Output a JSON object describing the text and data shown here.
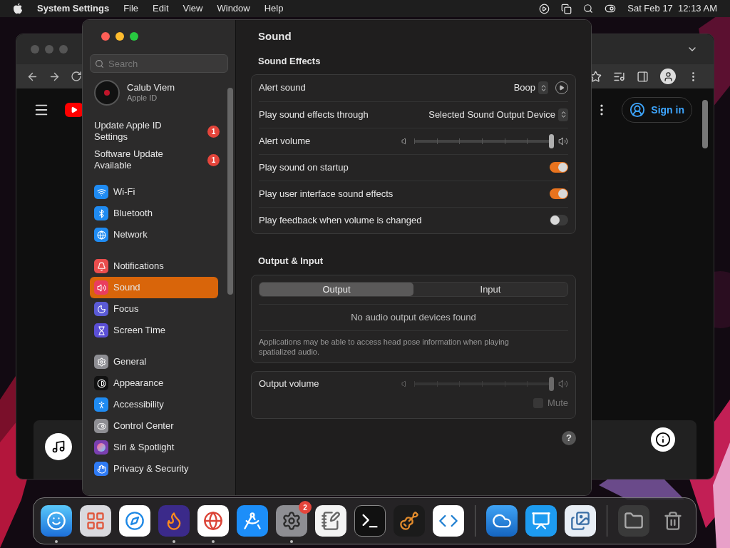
{
  "menu_bar": {
    "app_name": "System Settings",
    "menus": [
      "File",
      "Edit",
      "View",
      "Window",
      "Help"
    ],
    "clock": "Sat Feb 17  12:13 AM"
  },
  "browser": {
    "sign_in": "Sign in"
  },
  "settings": {
    "search": {
      "placeholder": "Search"
    },
    "account": {
      "name": "Calub Viem",
      "subtitle": "Apple ID"
    },
    "notices": [
      {
        "text": "Update Apple ID Settings",
        "badge": "1"
      },
      {
        "text": "Software Update Available",
        "badge": "1"
      }
    ],
    "sidebar_groups": [
      [
        {
          "label": "Wi-Fi",
          "color": "#1f8bf2",
          "selected": false
        },
        {
          "label": "Bluetooth",
          "color": "#1f8bf2",
          "selected": false
        },
        {
          "label": "Network",
          "color": "#1f8bf2",
          "selected": false
        }
      ],
      [
        {
          "label": "Notifications",
          "color": "#ea4d4d",
          "selected": false
        },
        {
          "label": "Sound",
          "color": "#ea3d5f",
          "selected": true
        },
        {
          "label": "Focus",
          "color": "#5b5bd6",
          "selected": false
        },
        {
          "label": "Screen Time",
          "color": "#5b4fd6",
          "selected": false
        }
      ],
      [
        {
          "label": "General",
          "color": "#8e8e93",
          "selected": false
        },
        {
          "label": "Appearance",
          "color": "#111111",
          "selected": false
        },
        {
          "label": "Accessibility",
          "color": "#1f8bf2",
          "selected": false
        },
        {
          "label": "Control Center",
          "color": "#8e8e93",
          "selected": false
        },
        {
          "label": "Siri & Spotlight",
          "color": "#7a3fb0",
          "selected": false
        },
        {
          "label": "Privacy & Security",
          "color": "#2f7bf5",
          "selected": false
        }
      ]
    ],
    "title": "Sound",
    "sound_effects": {
      "heading": "Sound Effects",
      "rows": [
        {
          "kind": "select",
          "label": "Alert sound",
          "value": "Boop",
          "play_button": true
        },
        {
          "kind": "select",
          "label": "Play sound effects through",
          "value": "Selected Sound Output Device",
          "play_button": false
        },
        {
          "kind": "slider",
          "label": "Alert volume",
          "level": 1
        },
        {
          "kind": "toggle",
          "label": "Play sound on startup",
          "on": true
        },
        {
          "kind": "toggle",
          "label": "Play user interface sound effects",
          "on": true
        },
        {
          "kind": "toggle",
          "label": "Play feedback when volume is changed",
          "on": false
        }
      ]
    },
    "output_input": {
      "heading": "Output & Input",
      "tabs": [
        {
          "label": "Output",
          "selected": true
        },
        {
          "label": "Input",
          "selected": false
        }
      ],
      "message": "No audio output devices found",
      "note": "Applications may be able to access head pose information when playing spatialized audio."
    },
    "output_volume": {
      "label": "Output volume",
      "level": 1,
      "disabled": true,
      "mute": {
        "label": "Mute",
        "checked": false
      }
    },
    "help": "?"
  },
  "dock": {
    "sections": [
      [
        {
          "running": true
        },
        {
          "running": false
        },
        {
          "running": false
        },
        {
          "running": true
        },
        {
          "running": true
        },
        {
          "running": false
        },
        {
          "running": true,
          "badge": "2"
        },
        {
          "running": false
        },
        {
          "running": false
        },
        {
          "running": false
        },
        {
          "running": false
        }
      ],
      [
        {
          "running": false
        },
        {
          "running": false
        },
        {
          "running": false
        }
      ],
      [
        {
          "running": false
        },
        {
          "running": false
        }
      ]
    ]
  }
}
